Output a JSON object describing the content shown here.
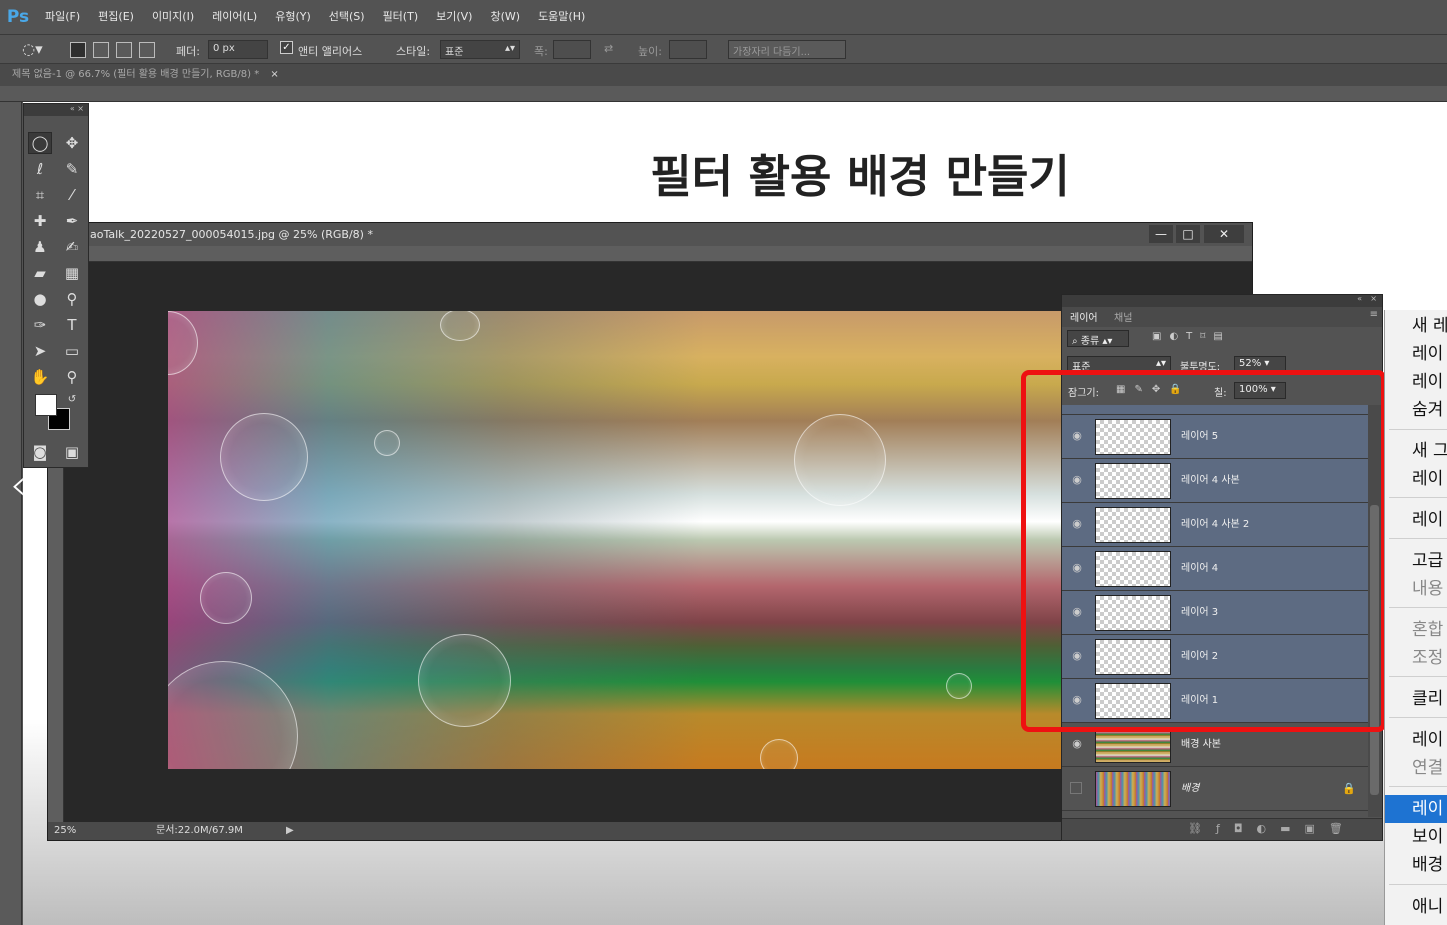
{
  "app": {
    "logo": "Ps"
  },
  "menu": [
    "파일(F)",
    "편집(E)",
    "이미지(I)",
    "레이어(L)",
    "유형(Y)",
    "선택(S)",
    "필터(T)",
    "보기(V)",
    "창(W)",
    "도움말(H)"
  ],
  "options": {
    "feather_label": "페더:",
    "feather_value": "0 px",
    "antialias_label": "앤티 앨리어스",
    "style_label": "스타일:",
    "style_value": "표준",
    "width_label": "폭:",
    "height_label": "높이:",
    "refine_edge_button": "가장자리 다듬기..."
  },
  "document_tab": "제목 없음-1 @ 66.7% (필터 활용 배경 만들기, RGB/8) *",
  "slide_title": "필터 활용 배경 만들기",
  "doc_window": {
    "title": "aoTalk_20220527_000054015.jpg @ 25% (RGB/8) *",
    "zoom": "25%",
    "doc_size": "문서:22.0M/67.9M",
    "min_btn": "—",
    "max_btn": "□",
    "close_btn": "✕"
  },
  "layers_panel": {
    "tab_layers": "레이어",
    "tab_channels": "채널",
    "filter_label": "종류",
    "blend_mode": "표준",
    "opacity_label": "불투명도:",
    "opacity_value": "52%",
    "lock_label": "잠그기:",
    "fill_label": "칠:",
    "fill_value": "100%",
    "layers": [
      {
        "name": "레이어 5",
        "visible": true,
        "selected": true
      },
      {
        "name": "레이어 4 사본",
        "visible": true,
        "selected": true
      },
      {
        "name": "레이어 4 사본 2",
        "visible": true,
        "selected": true
      },
      {
        "name": "레이어 4",
        "visible": true,
        "selected": true
      },
      {
        "name": "레이어 3",
        "visible": true,
        "selected": true
      },
      {
        "name": "레이어 2",
        "visible": true,
        "selected": true
      },
      {
        "name": "레이어 1",
        "visible": true,
        "selected": true
      },
      {
        "name": "배경 사본",
        "visible": true,
        "selected": false
      },
      {
        "name": "배경",
        "visible": false,
        "selected": false,
        "locked": true
      }
    ]
  },
  "context_menu": [
    "새 레",
    "레이",
    "레이",
    "숨겨",
    "새 그",
    "레이",
    "레이",
    "고급",
    "내용",
    "혼합",
    "조정",
    "클리",
    "레이",
    "연결",
    "레이",
    "보이",
    "배경",
    "애니"
  ],
  "highlight_color": "#1e73d2",
  "annotation_color": "#ee1111"
}
